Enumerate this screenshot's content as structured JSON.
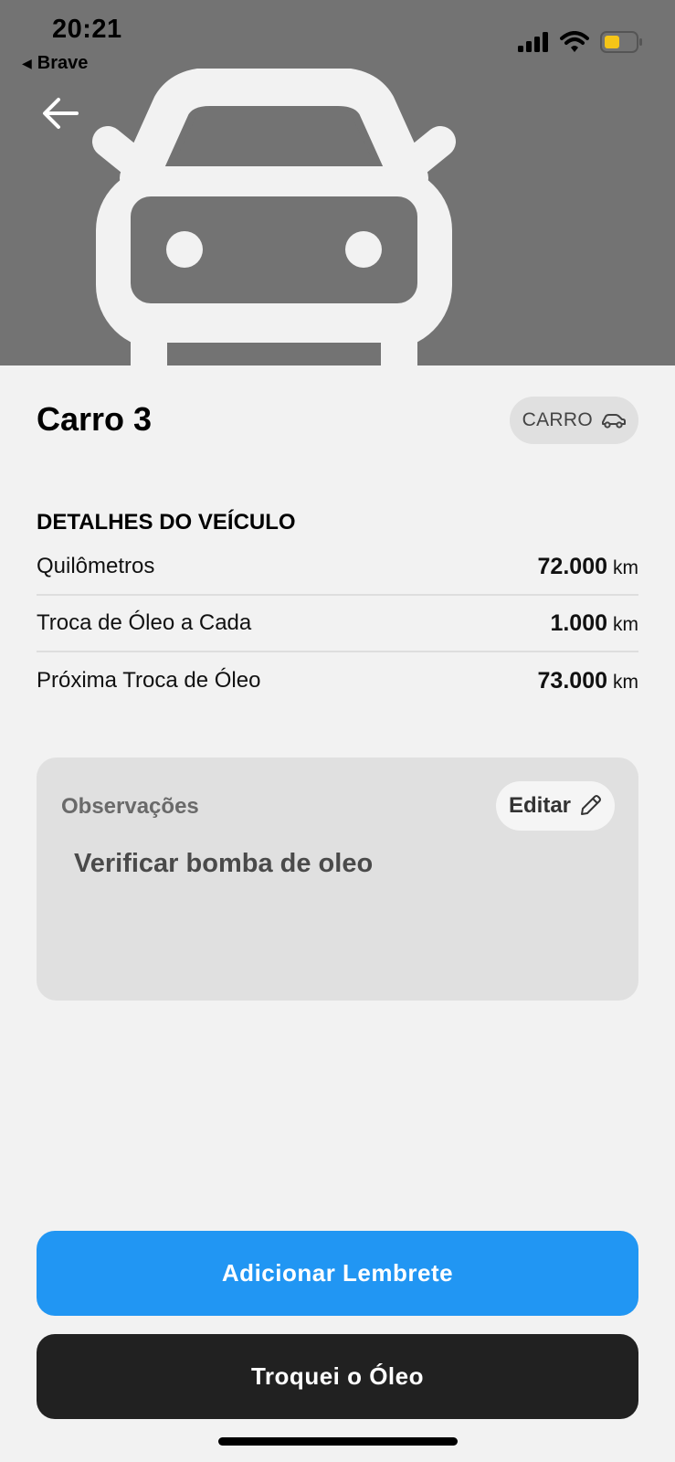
{
  "status_bar": {
    "time": "20:21",
    "back_app": "Brave",
    "icons": [
      "signal-icon",
      "wifi-icon",
      "battery-icon"
    ],
    "battery_color": "#f5c518"
  },
  "header": {
    "image": "car-icon",
    "background_color": "#737373"
  },
  "vehicle": {
    "name": "Carro 3",
    "type_label": "CARRO"
  },
  "details": {
    "section_title": "DETALHES DO VEÍCULO",
    "rows": [
      {
        "label": "Quilômetros",
        "value": "72.000",
        "unit": "km"
      },
      {
        "label": "Troca de Óleo a Cada",
        "value": "1.000",
        "unit": "km"
      },
      {
        "label": "Próxima Troca de Óleo",
        "value": "73.000",
        "unit": "km"
      }
    ]
  },
  "notes": {
    "label": "Observações",
    "edit_label": "Editar",
    "text": "Verificar bomba de oleo"
  },
  "actions": {
    "add_reminder": "Adicionar Lembrete",
    "oil_changed": "Troquei o Óleo",
    "primary_color": "#2196f3",
    "dark_color": "#212121"
  }
}
